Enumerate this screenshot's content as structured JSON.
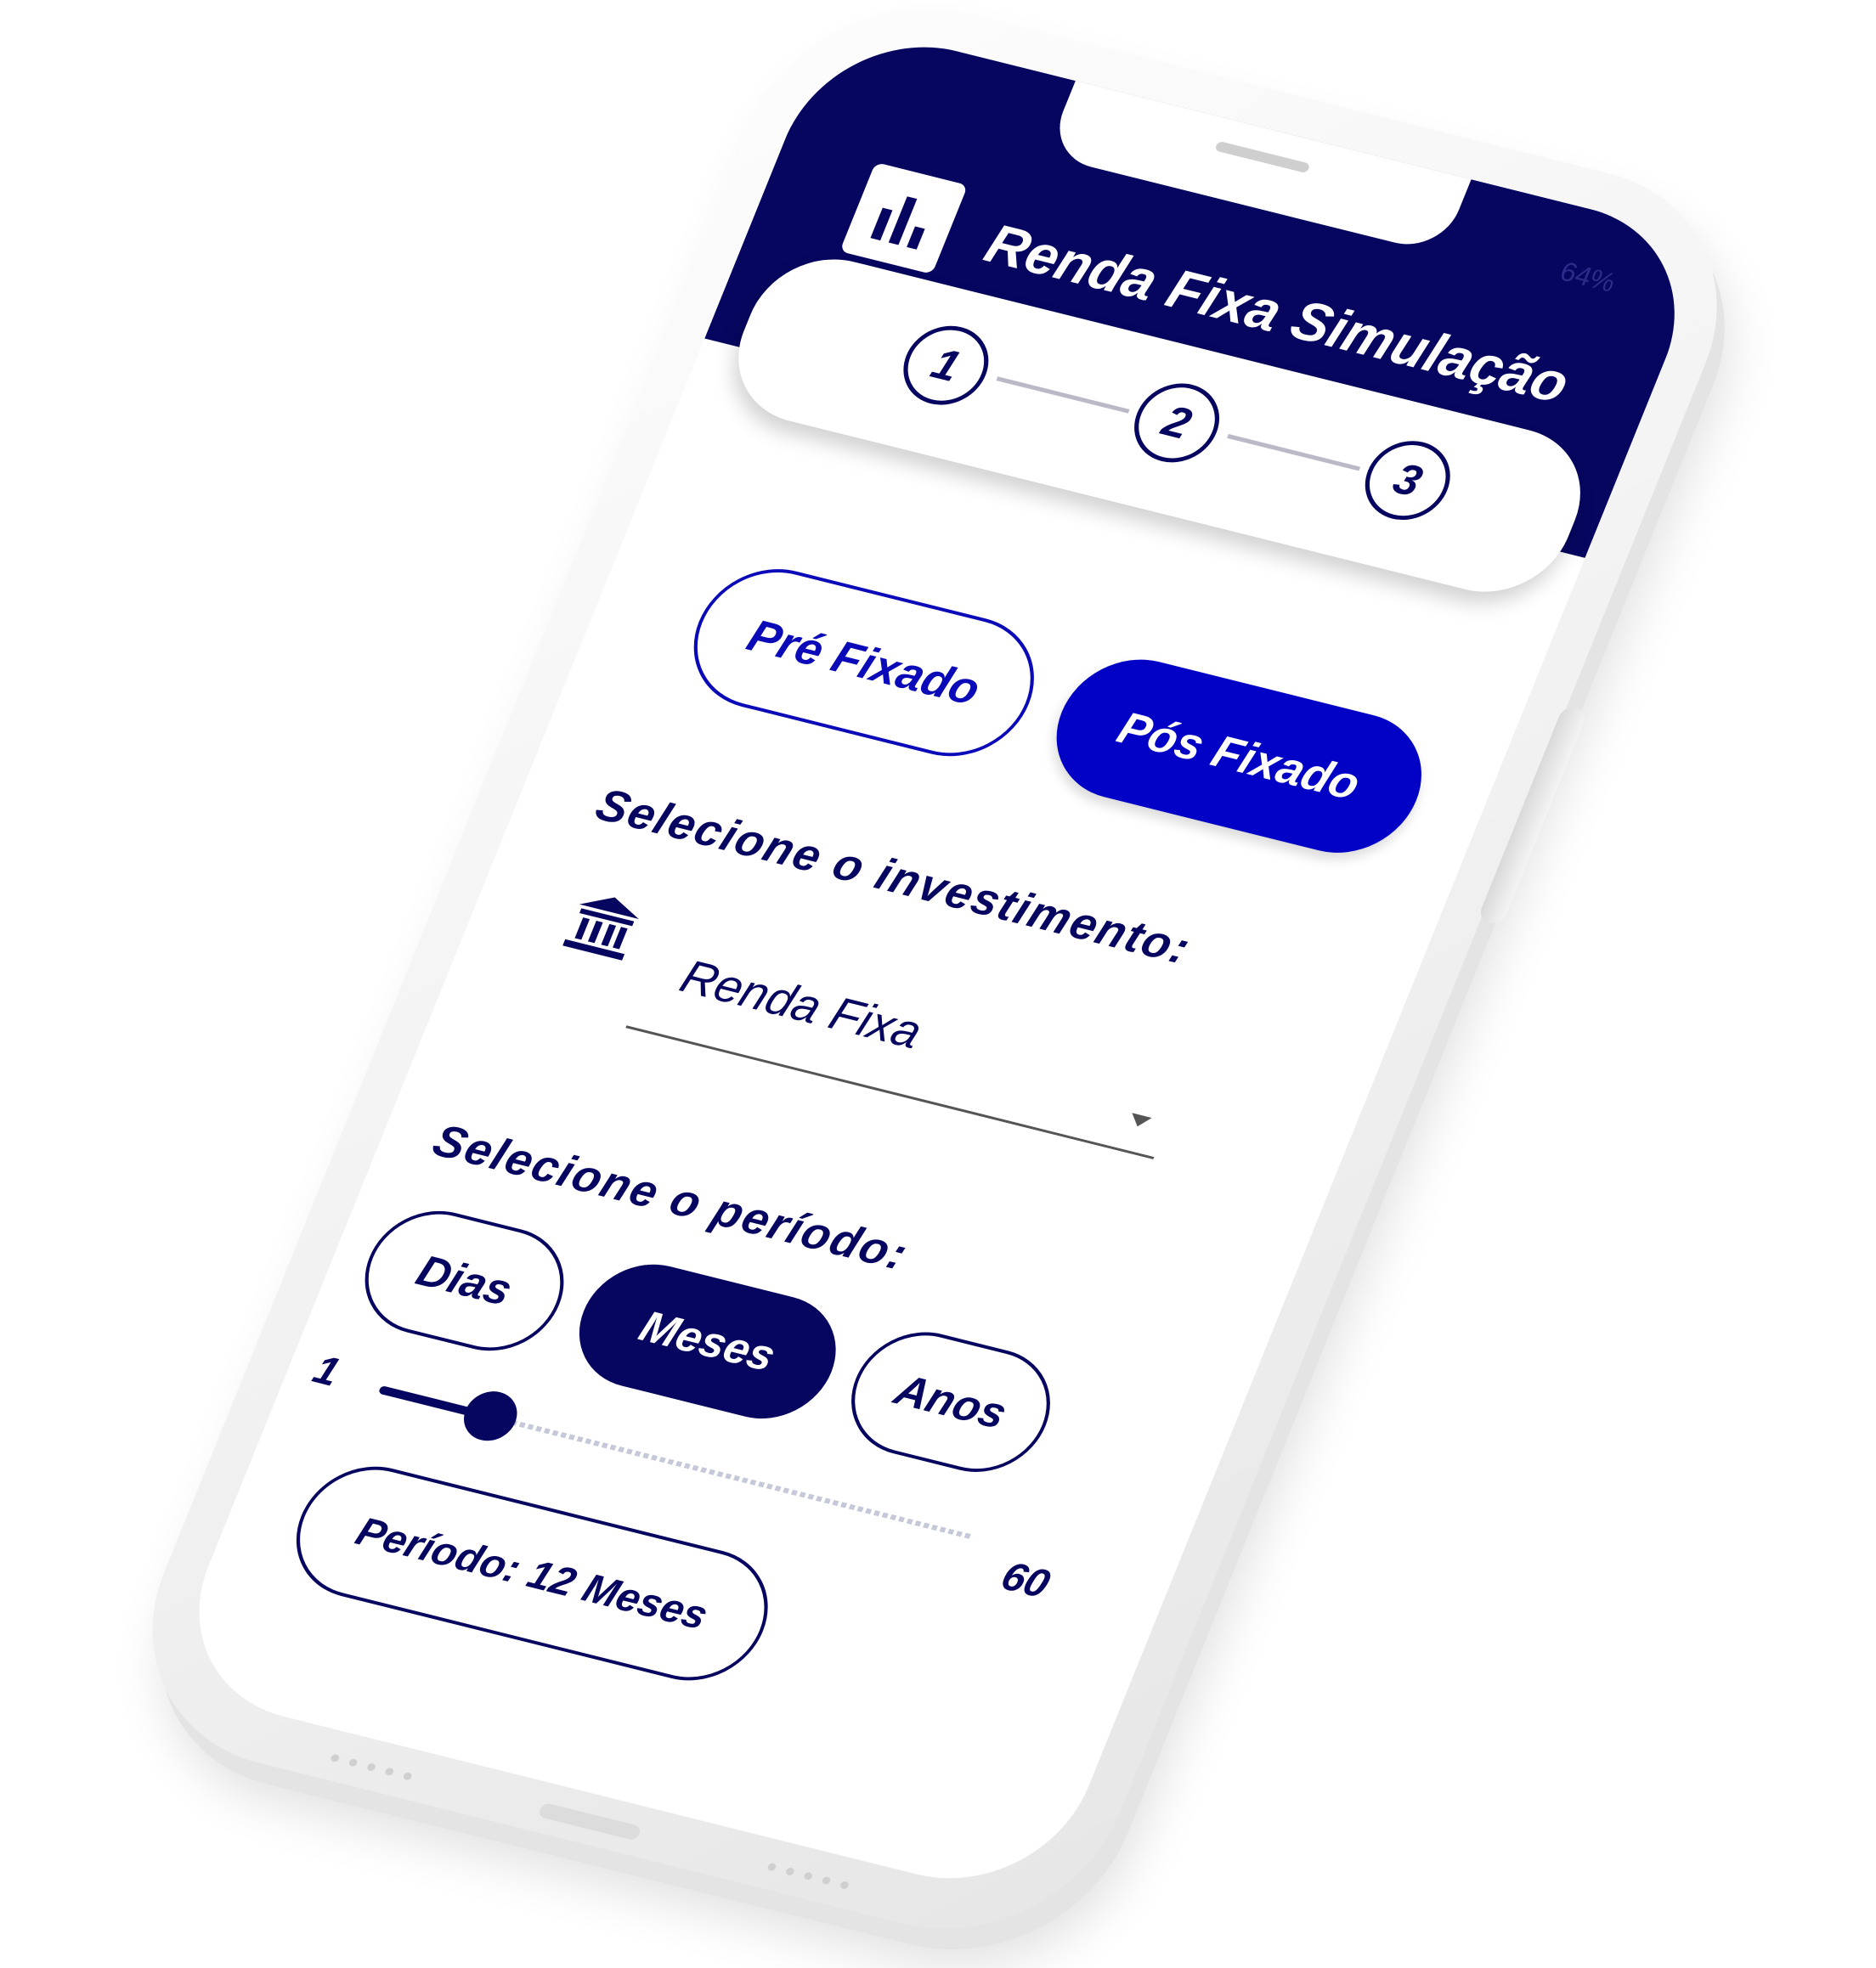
{
  "status_bar": {
    "battery": "64%"
  },
  "header": {
    "title": "Renda Fixa Simulação",
    "logo_icon": "bar-chart-icon"
  },
  "stepper": {
    "steps": [
      "1",
      "2",
      "3"
    ],
    "active_step": 1
  },
  "investment_type": {
    "options": [
      "Pré Fixado",
      "Pós Fixado"
    ],
    "selected": "Pós Fixado"
  },
  "investment": {
    "label": "Selecione o investimento:",
    "icon": "bank-icon",
    "selected_value": "Renda Fixa"
  },
  "period": {
    "label": "Selecione o período:",
    "options": [
      "Dias",
      "Meses",
      "Anos"
    ],
    "selected": "Meses",
    "slider": {
      "min": "1",
      "max": "60",
      "value": 12
    },
    "summary": "Período: 12 Meses"
  },
  "colors": {
    "primary": "#060660",
    "accent": "#0202c6",
    "background": "#ffffff"
  }
}
